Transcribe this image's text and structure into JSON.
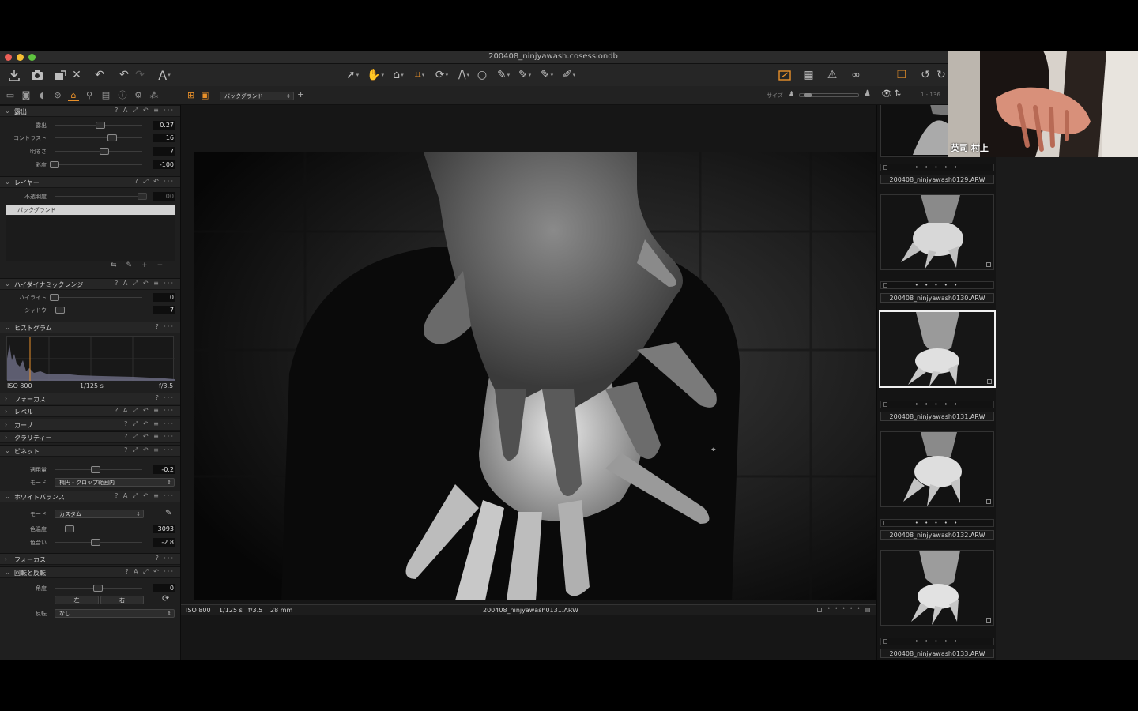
{
  "window": {
    "title": "200408_ninjyawash.cosessiondb"
  },
  "toolbar": {
    "text_tool": "A"
  },
  "viewer_bar": {
    "layer_select": "バックグランド",
    "size_label": "サイズ",
    "count": "1 - 136"
  },
  "exposure": {
    "title": "露出",
    "icons": "? A ⤢ ↶ ≡ ···",
    "rows": [
      {
        "label": "露出",
        "value": "0.27"
      },
      {
        "label": "コントラスト",
        "value": "16"
      },
      {
        "label": "明るさ",
        "value": "7"
      },
      {
        "label": "彩度",
        "value": "-100"
      }
    ]
  },
  "layers": {
    "title": "レイヤー",
    "icons": "? ⤢ ↶ ···",
    "opacity_label": "不透明度",
    "opacity_value": "100",
    "layer_item": "バックグランド"
  },
  "hdr": {
    "title": "ハイダイナミックレンジ",
    "icons": "? A ⤢ ↶ ≡ ···",
    "rows": [
      {
        "label": "ハイライト",
        "value": "0"
      },
      {
        "label": "シャドウ",
        "value": "7"
      }
    ]
  },
  "histogram": {
    "title": "ヒストグラム",
    "icons": "? ···",
    "iso": "ISO 800",
    "shutter": "1/125 s",
    "aperture": "f/3.5"
  },
  "focus1": {
    "title": "フォーカス",
    "icons": "? ···"
  },
  "levels": {
    "title": "レベル",
    "icons": "? A ⤢ ↶ ≡ ···"
  },
  "curve": {
    "title": "カーブ",
    "icons": "? ⤢ ↶ ≡ ···"
  },
  "clarity": {
    "title": "クラリティー",
    "icons": "? ⤢ ↶ ≡ ···"
  },
  "vignette": {
    "title": "ビネット",
    "icons": "? ⤢ ↶ ≡ ···",
    "amount_label": "適用量",
    "amount_value": "-0.2",
    "mode_label": "モード",
    "mode_value": "楕円 - クロップ範囲内"
  },
  "white_balance": {
    "title": "ホワイトバランス",
    "icons": "? A ⤢ ↶ ≡ ···",
    "mode_label": "モード",
    "mode_value": "カスタム",
    "rows": [
      {
        "label": "色温度",
        "value": "3093"
      },
      {
        "label": "色合い",
        "value": "-2.8"
      }
    ]
  },
  "focus2": {
    "title": "フォーカス",
    "icons": "? ···"
  },
  "rotate": {
    "title": "回転と反転",
    "icons": "? A ⤢ ↶ ···",
    "angle_label": "角度",
    "angle_value": "0",
    "left_btn": "左",
    "right_btn": "右",
    "flip_label": "反転",
    "flip_value": "なし"
  },
  "infobar": {
    "iso": "ISO 800",
    "shutter": "1/125 s",
    "aperture": "f/3.5",
    "focal": "28 mm",
    "filename": "200408_ninjyawash0131.ARW",
    "stars": "• • • • •"
  },
  "browser": {
    "items": [
      {
        "name": "200408_ninjyawash0129.ARW",
        "stars": "• • • • •"
      },
      {
        "name": "200408_ninjyawash0130.ARW",
        "stars": "• • • • •"
      },
      {
        "name": "200408_ninjyawash0131.ARW",
        "stars": "• • • • •"
      },
      {
        "name": "200408_ninjyawash0132.ARW",
        "stars": "• • • • •"
      },
      {
        "name": "200408_ninjyawash0133.ARW",
        "stars": "• • • • •"
      }
    ]
  },
  "video": {
    "participant_name": "英司 村上"
  },
  "colors": {
    "accent": "#e8902a",
    "panel": "#1f1f1f",
    "selection": "#f0f0f0"
  }
}
